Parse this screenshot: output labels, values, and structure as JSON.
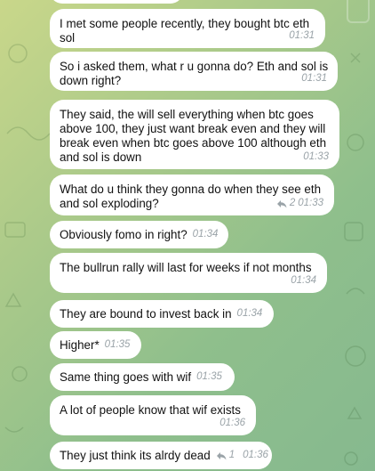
{
  "messages": [
    {
      "text": "I met some people recently, they bought btc eth\nsol",
      "time": "01:31"
    },
    {
      "text": "So i asked them, what r u gonna do? Eth and sol is\ndown right?",
      "time": "01:31"
    },
    {
      "text": "They said, the will sell everything when btc goes\nabove 100, they just want break even and they will\nbreak even when btc goes above 100 although eth\nand sol is down",
      "time": "01:33"
    },
    {
      "text": "What do u think they gonna do when they see eth\nand sol exploding?",
      "time": "01:33",
      "reply_count": "2"
    },
    {
      "text": "Obviously fomo in right?",
      "time": "01:34"
    },
    {
      "text": "The bullrun rally will last for weeks if not months",
      "time": "01:34"
    },
    {
      "text": "They are bound to invest back in",
      "time": "01:34"
    },
    {
      "text": "Higher*",
      "time": "01:35"
    },
    {
      "text": "Same thing goes with wif",
      "time": "01:35"
    },
    {
      "text": "A lot of people know that wif exists",
      "time": "01:36"
    },
    {
      "text": "They just think its alrdy dead",
      "time": "01:36",
      "reply_count": "1"
    }
  ],
  "icons": {
    "reply": "reply-arrow-icon"
  },
  "colors": {
    "bubble": "#ffffff",
    "timestamp": "#9aa3a8",
    "background": "#a9c98a"
  }
}
